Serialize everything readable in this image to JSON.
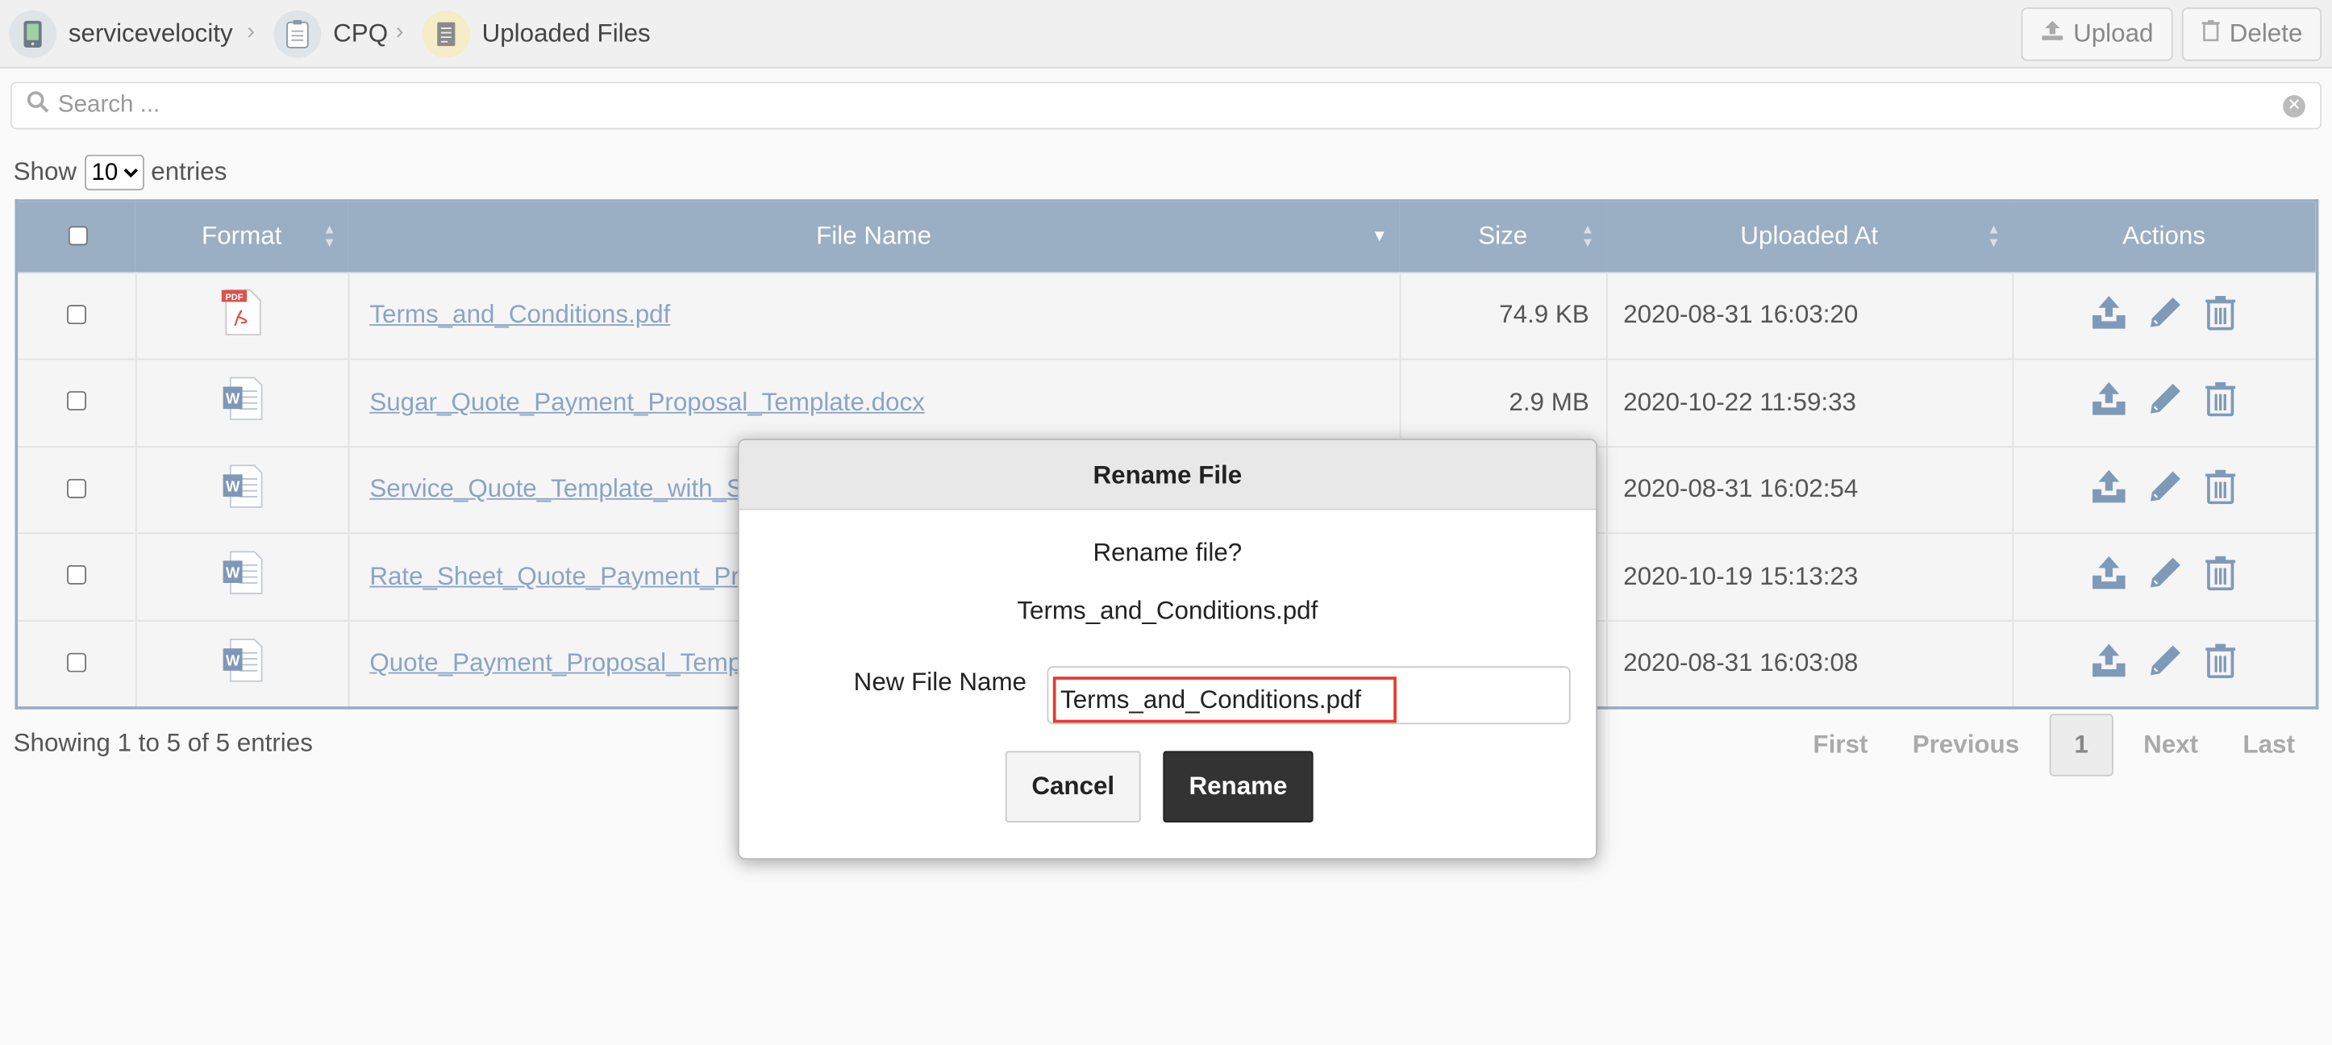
{
  "breadcrumb": {
    "items": [
      {
        "label": "servicevelocity",
        "icon": "app-icon"
      },
      {
        "label": "CPQ",
        "icon": "clipboard-icon"
      },
      {
        "label": "Uploaded Files",
        "icon": "document-icon"
      }
    ]
  },
  "toolbar": {
    "upload_label": "Upload",
    "delete_label": "Delete"
  },
  "search": {
    "placeholder": "Search ..."
  },
  "length_menu": {
    "show": "Show",
    "selected": "10",
    "entries": "entries"
  },
  "table": {
    "columns": [
      "Format",
      "File Name",
      "Size",
      "Uploaded At",
      "Actions"
    ],
    "rows": [
      {
        "format": "pdf",
        "name": "Terms_and_Conditions.pdf",
        "size": "74.9 KB",
        "uploaded": "2020-08-31 16:03:20"
      },
      {
        "format": "docx",
        "name": "Sugar_Quote_Payment_Proposal_Template.docx",
        "size": "2.9 MB",
        "uploaded": "2020-10-22 11:59:33"
      },
      {
        "format": "docx",
        "name": "Service_Quote_Template_with_S",
        "size": "",
        "uploaded": "2020-08-31 16:02:54"
      },
      {
        "format": "docx",
        "name": "Rate_Sheet_Quote_Payment_Pro",
        "size": "",
        "uploaded": "2020-10-19 15:13:23"
      },
      {
        "format": "docx",
        "name": "Quote_Payment_Proposal_Temp",
        "size": "",
        "uploaded": "2020-08-31 16:03:08"
      }
    ]
  },
  "info": "Showing 1 to 5 of 5 entries",
  "pager": {
    "first": "First",
    "previous": "Previous",
    "current": "1",
    "next": "Next",
    "last": "Last"
  },
  "modal": {
    "title": "Rename File",
    "question": "Rename file?",
    "filename": "Terms_and_Conditions.pdf",
    "field_label": "New File Name",
    "field_value": "Terms_and_Conditions.pdf",
    "cancel": "Cancel",
    "rename": "Rename"
  },
  "colors": {
    "header_bg": "#9aaec4",
    "link": "#8ba4c4",
    "highlight": "#e53b2f",
    "primary_btn": "#333333"
  }
}
